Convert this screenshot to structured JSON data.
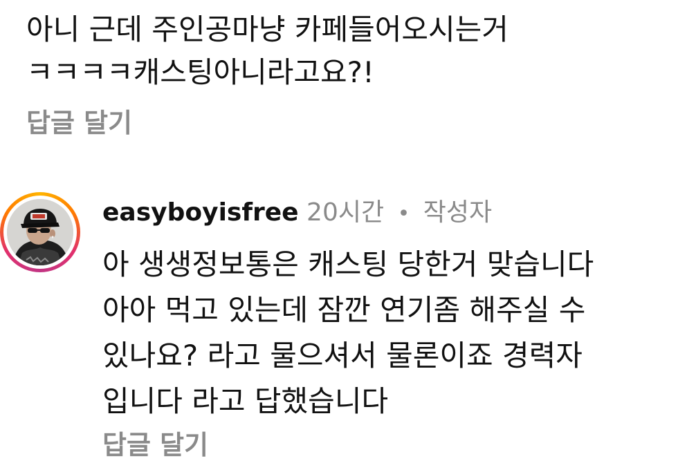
{
  "previous_comment": {
    "text": "아니 근데 주인공마냥  카페들어오시는거\nㅋㅋㅋㅋ캐스팅아니라고요?!",
    "reply_label": "답글 달기"
  },
  "comment": {
    "username": "easyboyisfree",
    "time_ago": "20시간",
    "separator": "•",
    "author_tag": "작성자",
    "text": "아 생생정보통은 캐스팅 당한거 맞습니다\n아아 먹고 있는데 잠깐 연기좀 해주실 수\n있나요? 라고 물으셔서 물론이죠 경력자\n입니다 라고 답했습니다",
    "reply_label": "답글 달기"
  },
  "colors": {
    "text": "#111111",
    "muted": "#8a8a8a",
    "story_ring": [
      "#ffb400",
      "#ff7a00",
      "#e1306c",
      "#c13584"
    ]
  },
  "icons": {
    "avatar": "user-avatar-photo"
  }
}
